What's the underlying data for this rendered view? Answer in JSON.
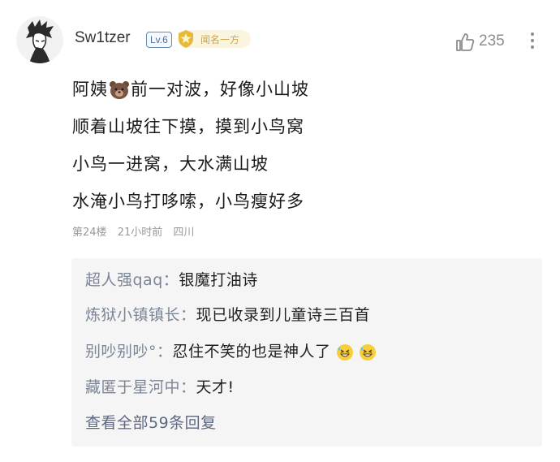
{
  "comment": {
    "username": "Sw1tzer",
    "level": "Lv.6",
    "badge_text": "闻名一方",
    "like_count": "235",
    "lines": [
      {
        "before": "阿姨",
        "emoji": "bear-face",
        "after": "前一对波，好像小山坡"
      },
      {
        "text": "顺着山坡往下摸，摸到小鸟窝"
      },
      {
        "text": "小鸟一进窝，大水满山坡"
      },
      {
        "text": "水淹小鸟打哆嗦，小鸟瘦好多"
      }
    ],
    "floor": "第24楼",
    "time": "21小时前",
    "location": "四川"
  },
  "replies": [
    {
      "name": "超人强qaq：",
      "text": "银魔打油诗"
    },
    {
      "name": "炼狱小镇镇长：",
      "text": "现已收录到儿童诗三百首"
    },
    {
      "name": "别吵别吵°：",
      "text": "忍住不笑的也是神人了",
      "emojis": [
        "grinning-sweat-face",
        "grinning-sweat-face"
      ]
    },
    {
      "name": "藏匿于星河中：",
      "text": "天才!"
    }
  ],
  "view_all": "查看全部59条回复",
  "colors": {
    "reply_name": "#7b8598",
    "badge_bg": "#fbf4df",
    "badge_gold": "#e8b838",
    "level_blue": "#4f6f9a"
  }
}
